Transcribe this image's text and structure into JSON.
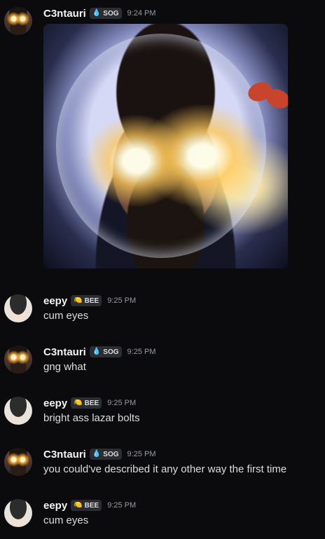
{
  "messages": [
    {
      "username": "C3ntauri",
      "tag": {
        "label": "SOG",
        "icon": "💧",
        "icon_name": "drop-icon",
        "color": "#23a55a"
      },
      "time": "9:24 PM",
      "attachment": {
        "type": "image",
        "alt": "photo with glowing eyes"
      }
    },
    {
      "username": "eepy",
      "tag": {
        "label": "BEE",
        "icon": "🍋",
        "icon_name": "lemon-icon",
        "color": "#f0b232"
      },
      "time": "9:25 PM",
      "text": "cum eyes"
    },
    {
      "username": "C3ntauri",
      "tag": {
        "label": "SOG",
        "icon": "💧",
        "icon_name": "drop-icon",
        "color": "#23a55a"
      },
      "time": "9:25 PM",
      "text": "gng what"
    },
    {
      "username": "eepy",
      "tag": {
        "label": "BEE",
        "icon": "🍋",
        "icon_name": "lemon-icon",
        "color": "#f0b232"
      },
      "time": "9:25 PM",
      "text": "bright ass lazar bolts"
    },
    {
      "username": "C3ntauri",
      "tag": {
        "label": "SOG",
        "icon": "💧",
        "icon_name": "drop-icon",
        "color": "#23a55a"
      },
      "time": "9:25 PM",
      "text": "you could've described it any other way the first time"
    },
    {
      "username": "eepy",
      "tag": {
        "label": "BEE",
        "icon": "🍋",
        "icon_name": "lemon-icon",
        "color": "#f0b232"
      },
      "time": "9:25 PM",
      "text": "cum eyes"
    }
  ]
}
